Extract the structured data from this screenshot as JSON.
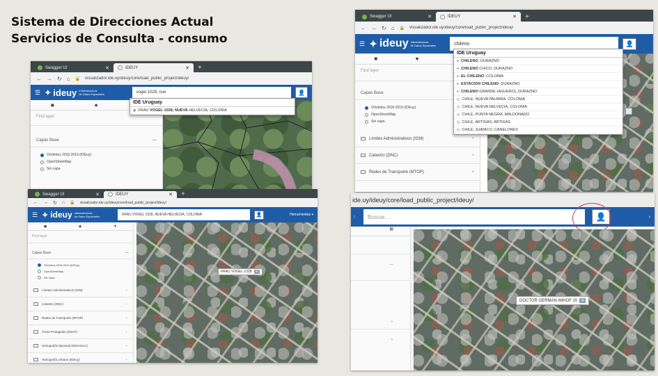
{
  "slide": {
    "title_line1": "Sistema de Direcciones Actual",
    "title_line2": "Servicios de Consulta - consumo"
  },
  "browser": {
    "tab1": "Swagger UI",
    "tab2": "IDEUY",
    "url": "visualizador.ide.uy/ideuy/core/load_public_project/ideuy/"
  },
  "ide": {
    "logo": "ideuy",
    "logo_sub1": "Infraestructura",
    "logo_sub2": "de Datos Espaciales",
    "find_layer": "Find layer",
    "base_layers": "Capas Base",
    "base_options": [
      "Ortofotos 2018-2019 (IDEuy)",
      "OpenStreetMap",
      "Sin capa"
    ],
    "layers": [
      "Límites Administrativos (IGM)",
      "Catastro (DNC)",
      "Redes de Transporte (MTOP)",
      "Áreas Protegidas (SNAP)",
      "Hidrografía Nacional (DINAGUA)",
      "Hidrografía Urbana (IDEuy)"
    ],
    "tools": "Herramientas ▾"
  },
  "win1": {
    "query": "vogel 1028, nue",
    "dd_head": "IDE Uruguay",
    "dd_item_pre": "FRAU ",
    "dd_item_bold": "VOGEL 1028, NUEVA",
    "dd_item_post": " HELVECIA, COLONIA"
  },
  "win2": {
    "tab2": "IDEUY",
    "query": "FRAU VOGEL 1028, NUEVA HELVECIA, COLONIA",
    "map_label": "FRAU VOGEL 1028"
  },
  "win3": {
    "query": "chileno",
    "dd_head": "IDE Uruguay",
    "results": [
      {
        "b": "CHILENO",
        "r": ", DURAZNO"
      },
      {
        "b": "CHILENO",
        "r": " CHICO, DURAZNO"
      },
      {
        "b": "EL CHILENO",
        "r": ", COLONIA"
      },
      {
        "b": "ESTACION CHILENO",
        "r": ", DURAZNO"
      },
      {
        "b": "CHILENO",
        "r": " GRANDE (AGUERO), DURAZNO"
      },
      {
        "b": "",
        "r": "CHILE, NUEVA PALMIRA, COLONIA"
      },
      {
        "b": "",
        "r": "CHILE, NUEVA HELVECIA, COLONIA"
      },
      {
        "b": "",
        "r": "CHILE, PUNTA NEGRA, MALDONADO"
      },
      {
        "b": "",
        "r": "CHILE, ARTIGAS, ARTIGAS"
      },
      {
        "b": "",
        "r": "CHILE, JUANICO, CANELONES"
      }
    ]
  },
  "win4": {
    "url_partial": "ide.uy/ideuy/core/load_public_project/ideuy/",
    "placeholder": "Buscar...",
    "map_label": "DOCTOR GERMAN IMHOF 20"
  }
}
